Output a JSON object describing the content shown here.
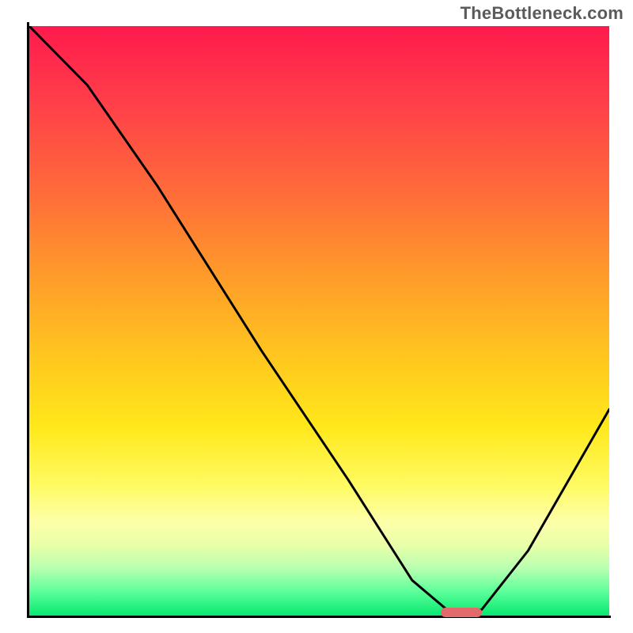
{
  "watermark": "TheBottleneck.com",
  "chart_data": {
    "type": "line",
    "title": "",
    "xlabel": "",
    "ylabel": "",
    "xlim": [
      0,
      100
    ],
    "ylim": [
      0,
      100
    ],
    "grid": false,
    "legend": false,
    "background_gradient": {
      "orientation": "vertical",
      "stops": [
        {
          "pos": 0.0,
          "color": "#ff1a4d"
        },
        {
          "pos": 0.28,
          "color": "#ff6b3a"
        },
        {
          "pos": 0.56,
          "color": "#ffc61f"
        },
        {
          "pos": 0.78,
          "color": "#fffb63"
        },
        {
          "pos": 0.92,
          "color": "#b8ffb0"
        },
        {
          "pos": 1.0,
          "color": "#07e86f"
        }
      ]
    },
    "series": [
      {
        "name": "bottleneck-curve",
        "x": [
          0,
          10,
          22,
          40,
          55,
          66,
          72,
          78,
          86,
          100
        ],
        "y": [
          100,
          90,
          73,
          45,
          23,
          6,
          1,
          1,
          11,
          35
        ]
      }
    ],
    "annotations": [
      {
        "name": "optimal-marker",
        "shape": "pill",
        "x_range": [
          71,
          78
        ],
        "y": 0.5,
        "color": "#e26a6a"
      }
    ]
  }
}
